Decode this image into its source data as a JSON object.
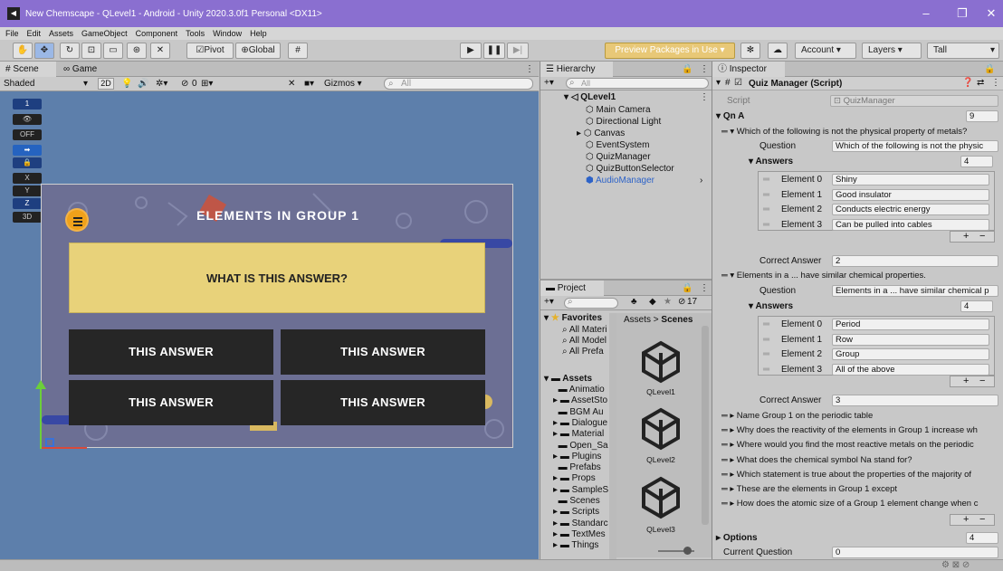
{
  "window": {
    "title": "New Chemscape - QLevel1 - Android - Unity 2020.3.0f1 Personal <DX11>"
  },
  "menu": [
    "File",
    "Edit",
    "Assets",
    "GameObject",
    "Component",
    "Tools",
    "Window",
    "Help"
  ],
  "toolbar": {
    "pivot": "Pivot",
    "global": "Global",
    "preview_packages": "Preview Packages in Use",
    "account": "Account",
    "layers": "Layers",
    "layout": "Tall"
  },
  "scene": {
    "tab_scene": "Scene",
    "tab_game": "Game",
    "shading": "Shaded",
    "mode_2d": "2D",
    "gizmos": "Gizmos",
    "search_placeholder": "All",
    "hidden_count": "0",
    "gizmo_labels": [
      "1",
      "OFF",
      "X",
      "Y",
      "Z",
      "3D"
    ],
    "game": {
      "title": "ELEMENTS IN GROUP 1",
      "question": "WHAT IS THIS ANSWER?",
      "answers": [
        "THIS ANSWER",
        "THIS ANSWER",
        "THIS ANSWER",
        "THIS ANSWER"
      ]
    }
  },
  "hierarchy": {
    "tab": "Hierarchy",
    "search_placeholder": "All",
    "root": "QLevel1",
    "items": [
      "Main Camera",
      "Directional Light",
      "Canvas",
      "EventSystem",
      "QuizManager",
      "QuizButtonSelector",
      "AudioManager"
    ]
  },
  "project": {
    "tab": "Project",
    "hidden_count": "17",
    "favorites_label": "Favorites",
    "favorites": [
      "All Materi",
      "All Model",
      "All Prefa"
    ],
    "assets_label": "Assets",
    "assets_folders": [
      "Animatio",
      "AssetSto",
      "BGM Au",
      "Dialogue",
      "Material",
      "Open_Sa",
      "Plugins",
      "Prefabs",
      "Props",
      "SampleS",
      "Scenes",
      "Scripts",
      "Standarc",
      "TextMes",
      "Things"
    ],
    "breadcrumb_root": "Assets",
    "breadcrumb_sep": ">",
    "breadcrumb_current": "Scenes",
    "files": [
      "QLevel1",
      "QLevel2",
      "QLevel3"
    ]
  },
  "inspector": {
    "tab": "Inspector",
    "component": "Quiz Manager (Script)",
    "script_label": "Script",
    "script_value": "QuizManager",
    "qna_label": "Qn A",
    "qna_size": "9",
    "q1": {
      "header": "Which of the following is not the physical property of metals?",
      "question_label": "Question",
      "question_value": "Which of the following is not the physic",
      "answers_label": "Answers",
      "answers_size": "4",
      "elements": [
        {
          "label": "Element 0",
          "value": "Shiny"
        },
        {
          "label": "Element 1",
          "value": "Good insulator"
        },
        {
          "label": "Element 2",
          "value": "Conducts electric energy"
        },
        {
          "label": "Element 3",
          "value": "Can be pulled into cables"
        }
      ],
      "correct_label": "Correct Answer",
      "correct_value": "2"
    },
    "q2": {
      "header": "Elements in a ... have similar chemical properties.",
      "question_label": "Question",
      "question_value": "Elements in a ... have similar chemical p",
      "answers_label": "Answers",
      "answers_size": "4",
      "elements": [
        {
          "label": "Element 0",
          "value": "Period"
        },
        {
          "label": "Element 1",
          "value": "Row"
        },
        {
          "label": "Element 2",
          "value": "Group"
        },
        {
          "label": "Element 3",
          "value": "All of the above"
        }
      ],
      "correct_label": "Correct Answer",
      "correct_value": "3"
    },
    "collapsed": [
      "Name Group 1 on the periodic table",
      "Why does the reactivity of the elements in Group 1 increase wh",
      "Where would you find the most reactive metals on the periodic",
      "What does the chemical symbol Na stand for?",
      "Which statement is true about the properties of the majority of",
      "These are the elements in Group 1 except",
      "How does the atomic size of a Group 1 element change when c"
    ],
    "options_label": "Options",
    "options_value": "4",
    "current_q_label": "Current Question",
    "current_q_value": "0"
  },
  "colors": {
    "title_bar": "#8a6fd0",
    "game_question": "#e8d27a",
    "game_button": "#262626",
    "selection": "#3a72d8"
  }
}
